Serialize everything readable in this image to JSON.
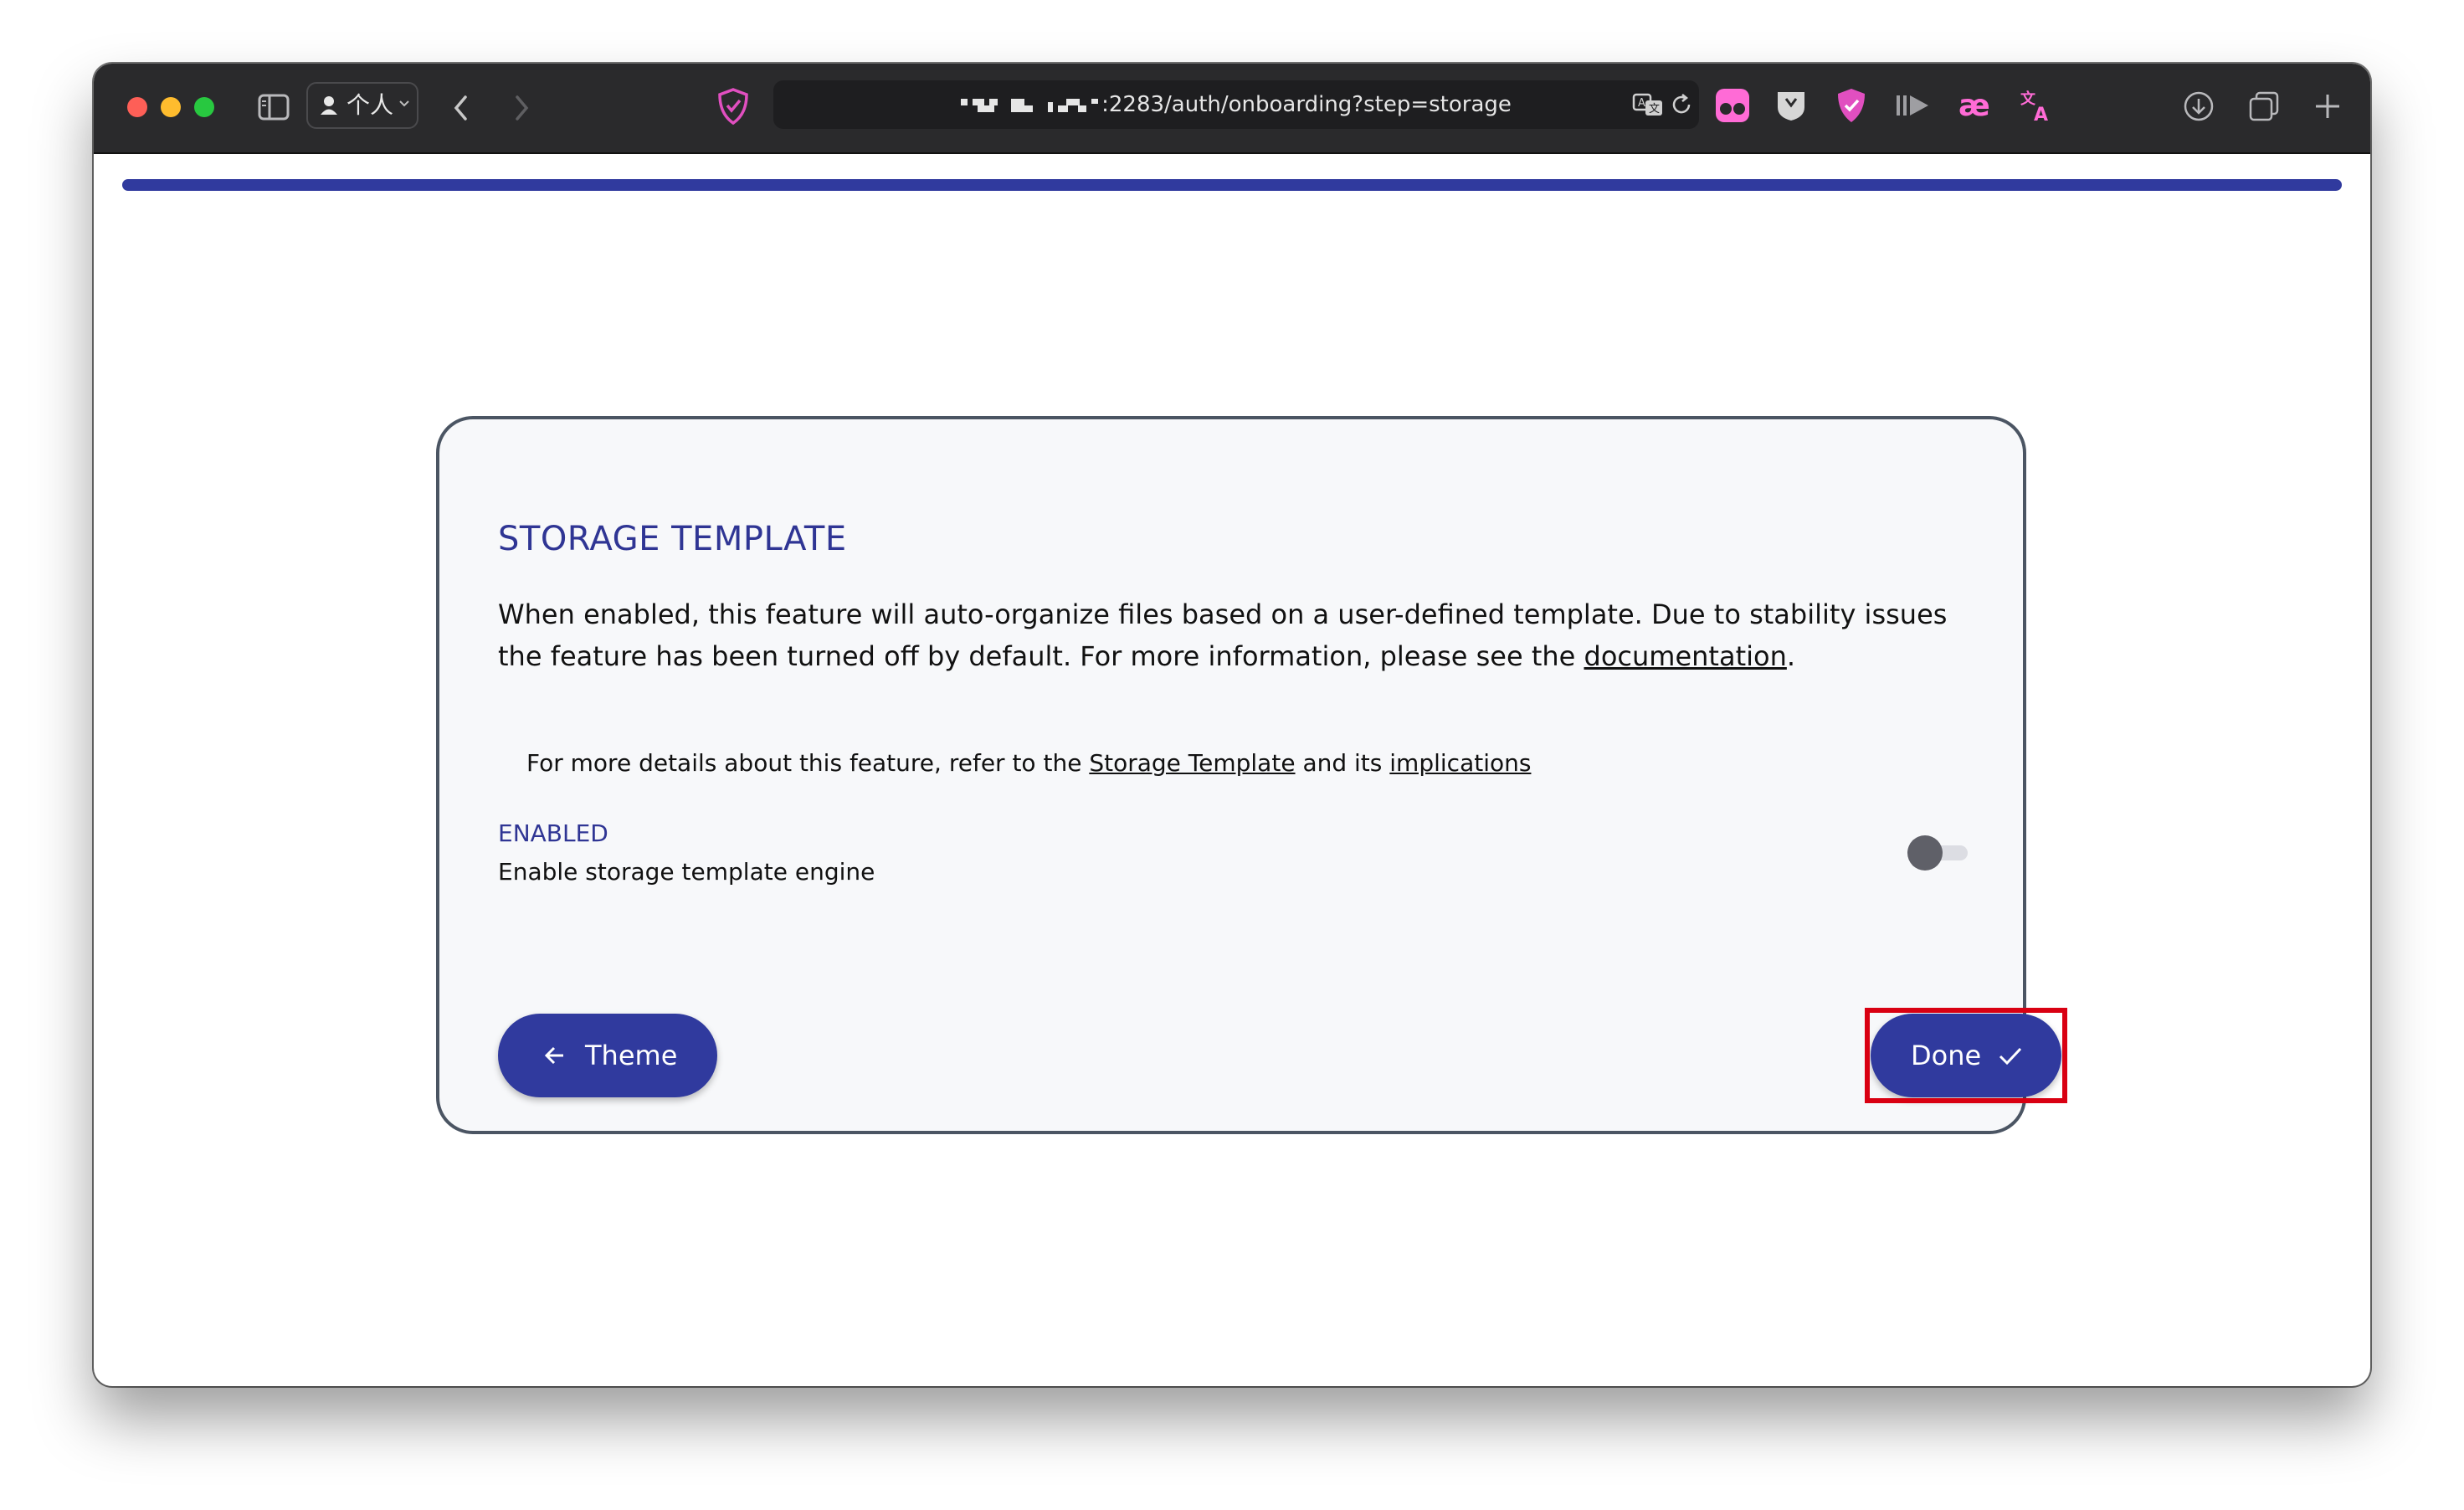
{
  "browser": {
    "profile_label": "个人",
    "url": ":2283/auth/onboarding?step=storage"
  },
  "onboarding": {
    "progress": 1.0,
    "title": "STORAGE TEMPLATE",
    "description": "When enabled, this feature will auto-organize files based on a user-defined template. Due to stability issues the feature has been turned off by default. For more information, please see the ",
    "description_link": "documentation",
    "description_end": ".",
    "details_prefix": "For more details about this feature, refer to the ",
    "details_link1": "Storage Template",
    "details_middle": " and its ",
    "details_link2": "implications",
    "setting": {
      "label": "ENABLED",
      "description": "Enable storage template engine",
      "enabled": false
    },
    "back_button": "Theme",
    "done_button": "Done"
  },
  "colors": {
    "accent": "#303a9e",
    "heading": "#2f3594",
    "highlight": "#d90012"
  }
}
